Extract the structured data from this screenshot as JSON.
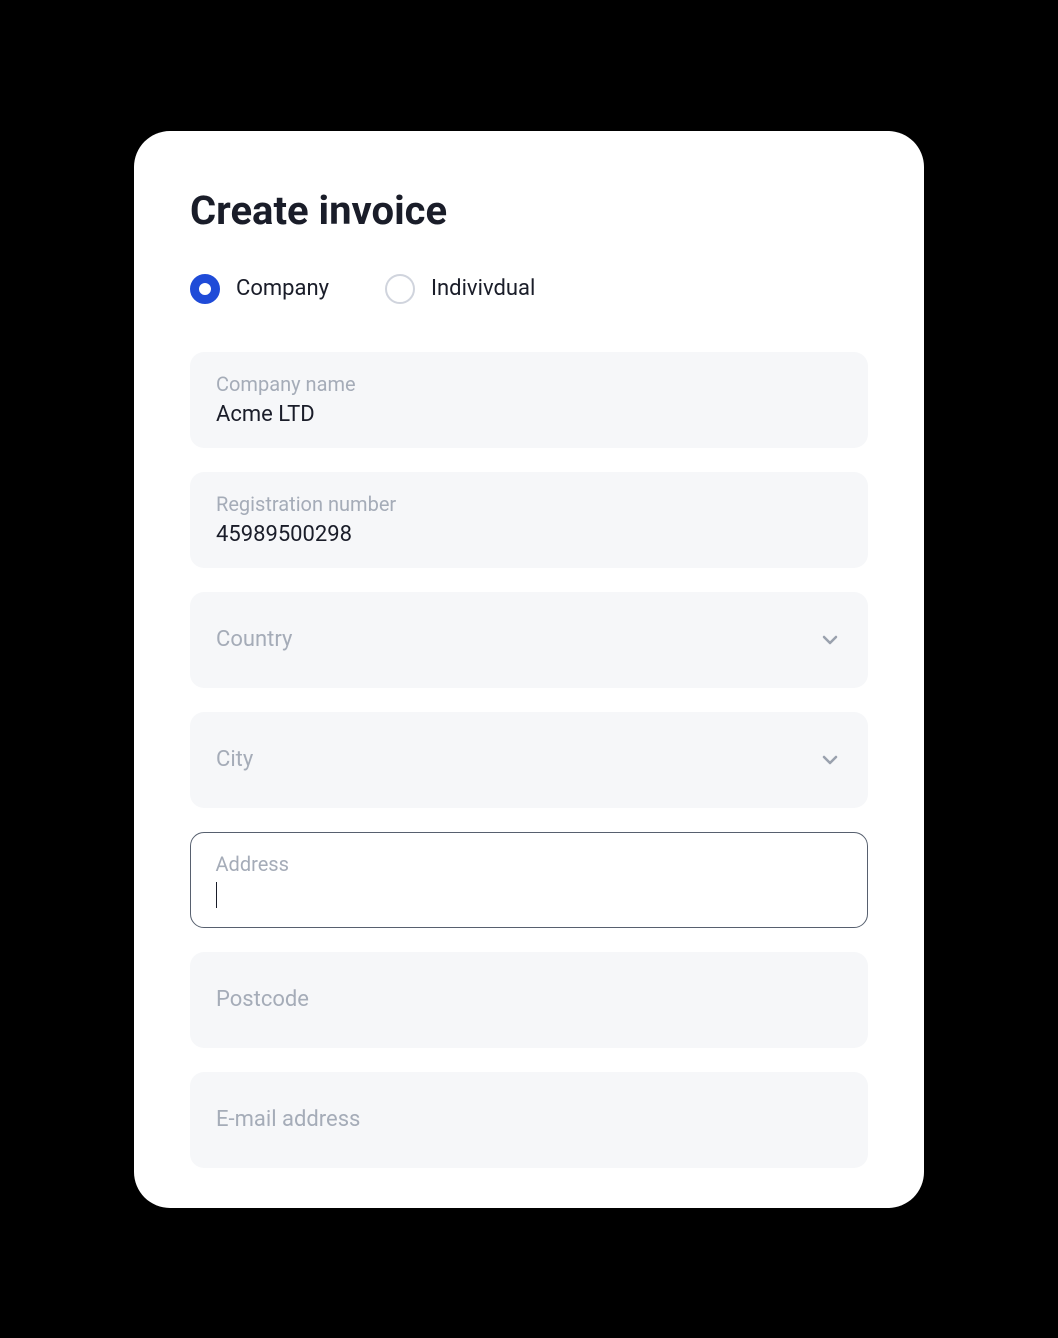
{
  "title": "Create invoice",
  "type_selector": {
    "options": [
      {
        "label": "Company",
        "selected": true
      },
      {
        "label": "Indivivdual",
        "selected": false
      }
    ]
  },
  "fields": {
    "company_name": {
      "label": "Company name",
      "value": "Acme LTD"
    },
    "registration_number": {
      "label": "Registration number",
      "value": "45989500298"
    },
    "country": {
      "label": "Country",
      "value": ""
    },
    "city": {
      "label": "City",
      "value": ""
    },
    "address": {
      "label": "Address",
      "value": ""
    },
    "postcode": {
      "label": "Postcode",
      "value": ""
    },
    "email": {
      "label": "E-mail address",
      "value": ""
    }
  },
  "colors": {
    "accent": "#1f4bd8",
    "field_bg": "#f6f7f9",
    "text_muted": "#a5acb8",
    "text": "#1a1d29"
  }
}
